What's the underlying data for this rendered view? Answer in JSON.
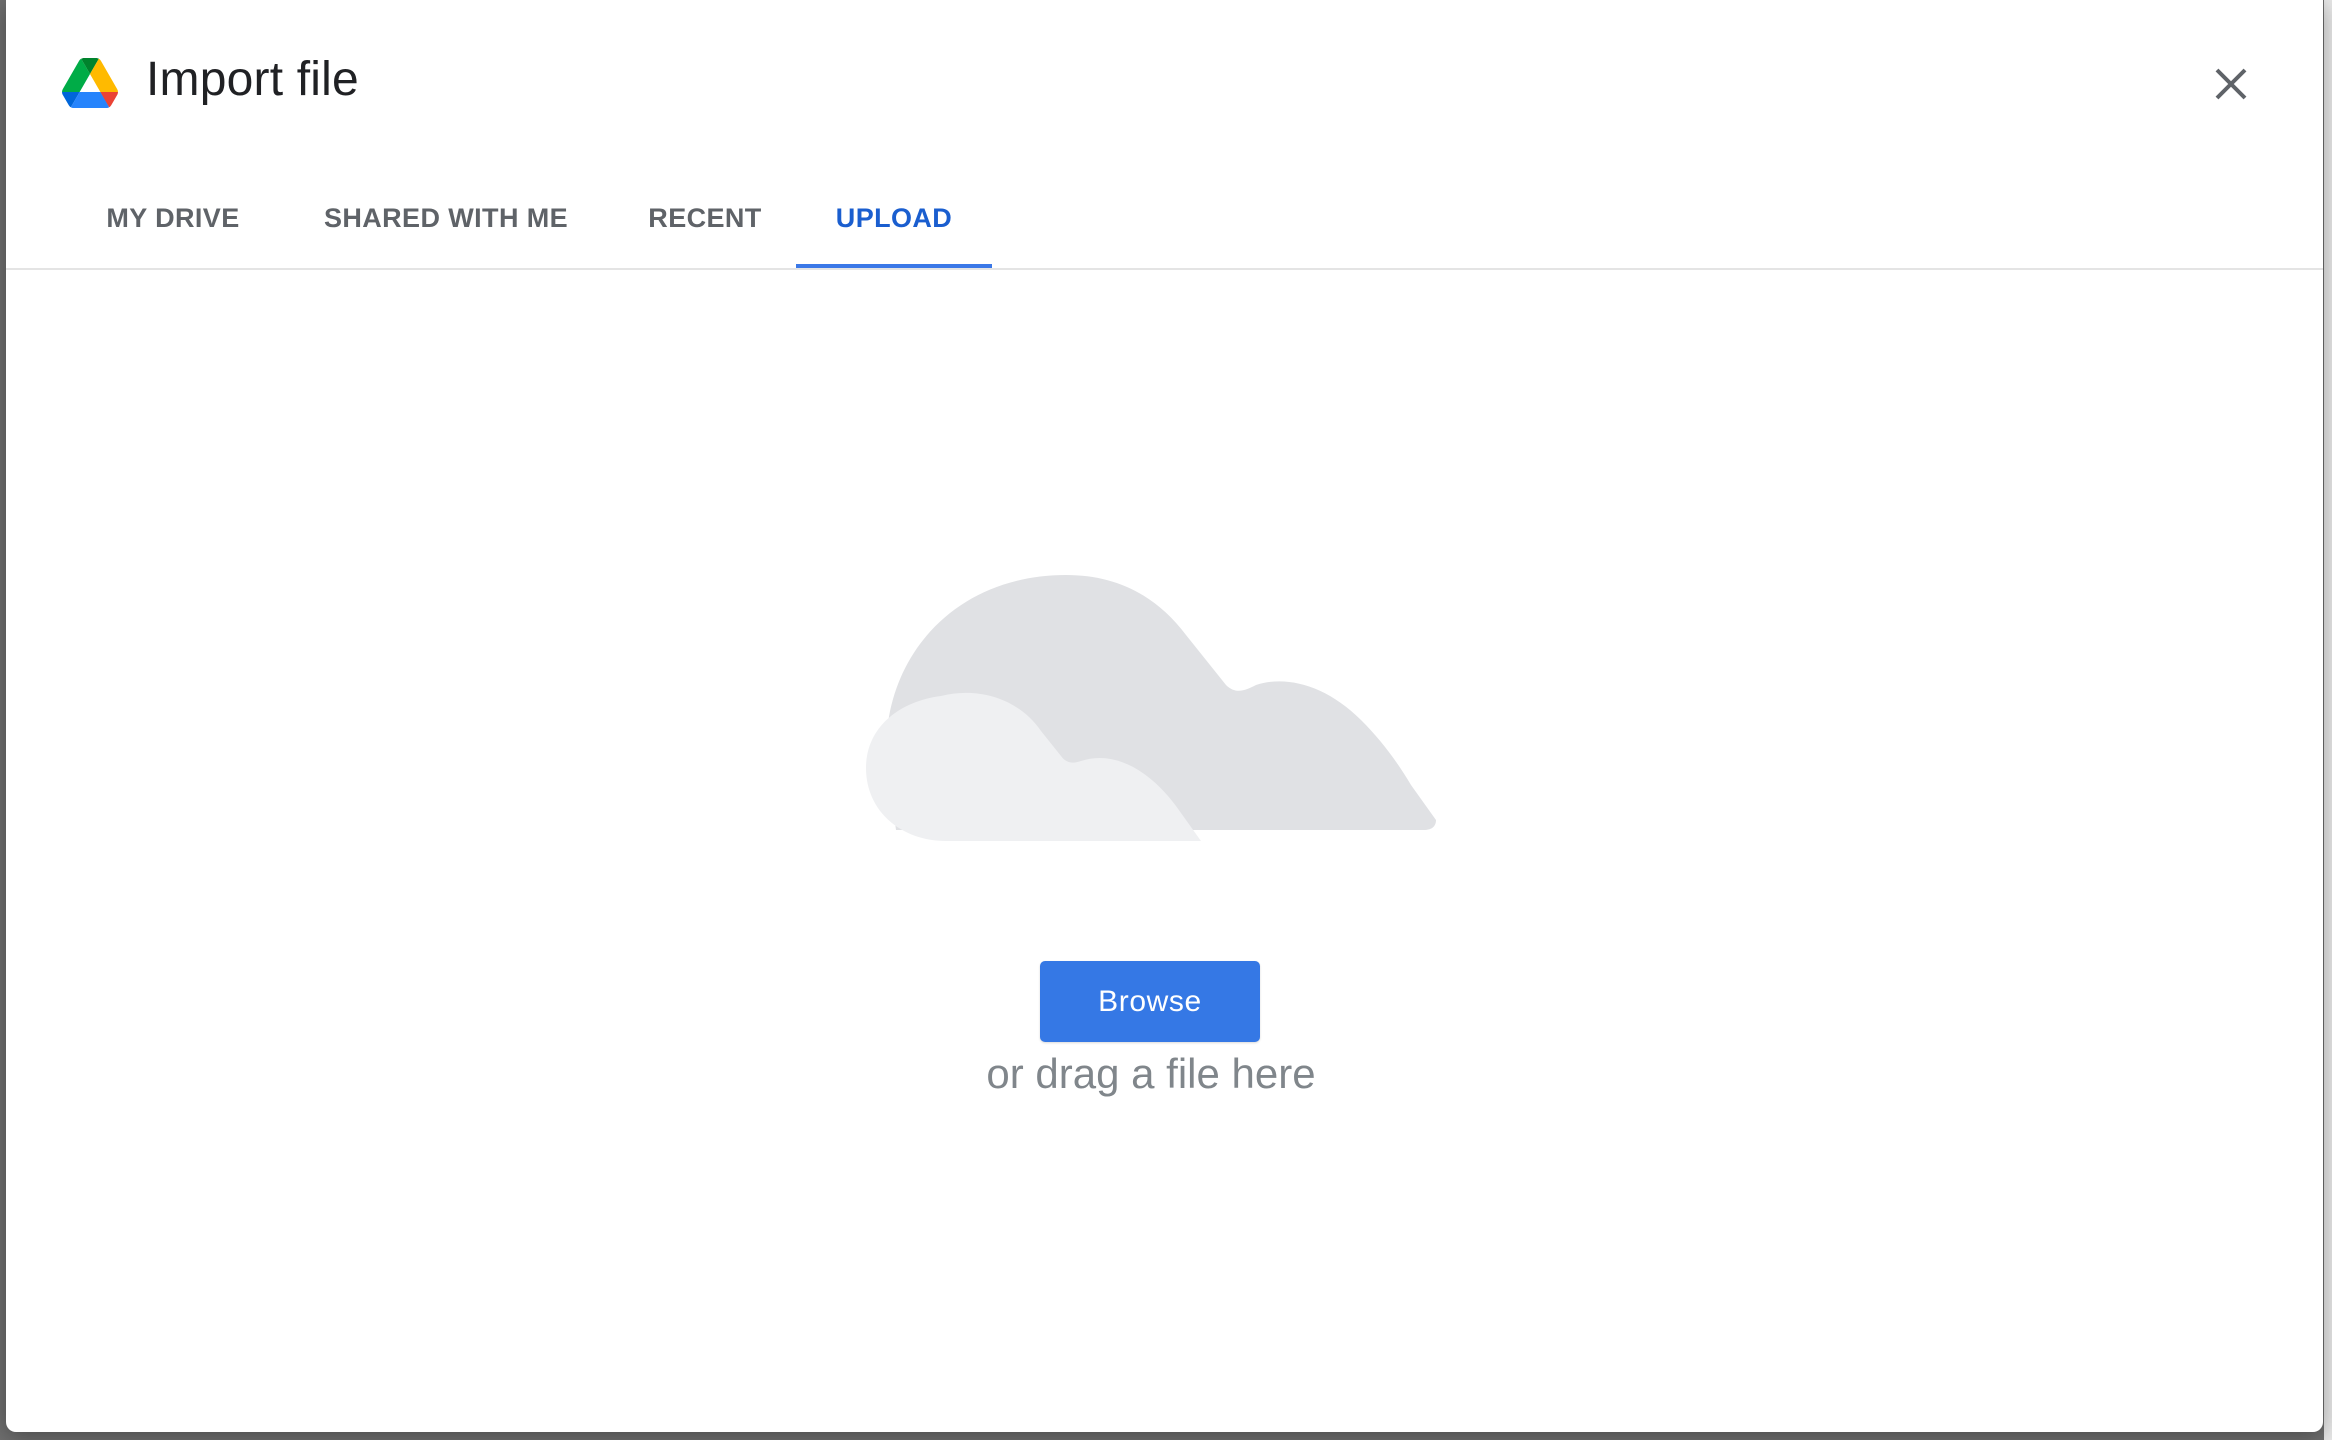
{
  "dialog": {
    "title": "Import file",
    "logo_icon": "google-drive-icon",
    "close_icon": "close-icon"
  },
  "tabs": [
    {
      "label": "MY DRIVE",
      "active": false
    },
    {
      "label": "SHARED WITH ME",
      "active": false
    },
    {
      "label": "RECENT",
      "active": false
    },
    {
      "label": "UPLOAD",
      "active": true
    }
  ],
  "upload": {
    "illustration_icon": "cloud-icon",
    "browse_label": "Browse",
    "drag_text": "or drag a file here"
  },
  "colors": {
    "accent": "#3578e5",
    "active_tab": "#1a5ecf",
    "tab_text": "#5f6368",
    "cloud_back": "#e0e1e4",
    "cloud_front": "#eff0f2"
  }
}
